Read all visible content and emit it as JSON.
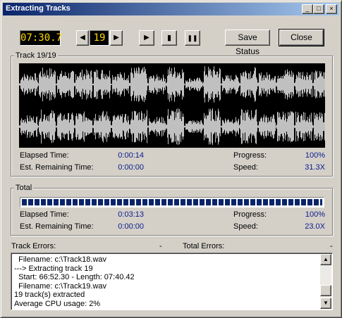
{
  "window": {
    "title": "Extracting Tracks",
    "minimize_glyph": "_",
    "maximize_glyph": "□",
    "close_glyph": "×"
  },
  "toolbar": {
    "time_display": "07:30.7",
    "prev_glyph": "◀",
    "track_number": "19",
    "next_glyph": "▶",
    "play_glyph": "▶",
    "stop_glyph": "▮",
    "pause_glyph": "❚❚",
    "save_status_label": "Save Status",
    "close_label": "Close"
  },
  "track": {
    "group_label": "Track 19/19",
    "elapsed_label": "Elapsed Time:",
    "elapsed_value": "0:00:14",
    "remaining_label": "Est. Remaining Time:",
    "remaining_value": "0:00:00",
    "progress_label": "Progress:",
    "progress_value": "100%",
    "speed_label": "Speed:",
    "speed_value": "31.3X"
  },
  "total": {
    "group_label": "Total",
    "progress_fraction": 1.0,
    "elapsed_label": "Elapsed Time:",
    "elapsed_value": "0:03:13",
    "remaining_label": "Est. Remaining Time:",
    "remaining_value": "0:00:00",
    "progress_label": "Progress:",
    "progress_value": "100%",
    "speed_label": "Speed:",
    "speed_value": "23.0X"
  },
  "errors": {
    "track_errors_label": "Track Errors:",
    "track_errors_value": "-",
    "total_errors_label": "Total Errors:",
    "total_errors_value": "-"
  },
  "log": {
    "lines": [
      "  Filename: c:\\Track18.wav",
      "---> Extracting track 19",
      "  Start: 66:52.30 - Length: 07:40.42",
      "  Filename: c:\\Track19.wav",
      "19 track(s) extracted",
      "Average CPU usage: 2%"
    ],
    "scroll_up_glyph": "▲",
    "scroll_down_glyph": "▼"
  },
  "colors": {
    "waveform": "#c0c0c0",
    "value_text": "#0a1a8c",
    "lcd_text": "#ffd800",
    "progress_block": "#0a246a"
  }
}
